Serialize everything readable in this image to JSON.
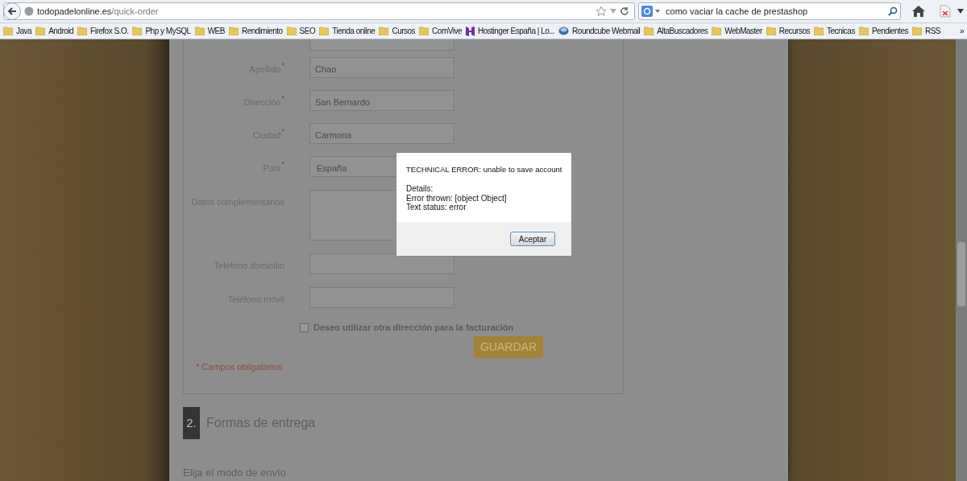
{
  "browser": {
    "url_domain": "todopadelonline.es",
    "url_path": "/quick-order",
    "search_query": "como vaciar la cache de prestashop",
    "bookmarks": [
      {
        "label": "Java",
        "kind": "folder"
      },
      {
        "label": "Android",
        "kind": "folder"
      },
      {
        "label": "Firefox S.O.",
        "kind": "folder"
      },
      {
        "label": "Php y MySQL",
        "kind": "folder"
      },
      {
        "label": "WEB",
        "kind": "folder"
      },
      {
        "label": "Rendimiento",
        "kind": "folder"
      },
      {
        "label": "SEO",
        "kind": "folder"
      },
      {
        "label": "Tienda online",
        "kind": "folder"
      },
      {
        "label": "Cursos",
        "kind": "folder"
      },
      {
        "label": "ComVive",
        "kind": "folder"
      },
      {
        "label": "Hostinger España | Lo...",
        "kind": "site"
      },
      {
        "label": "Roundcube Webmail",
        "kind": "mail"
      },
      {
        "label": "AltaBuscadores",
        "kind": "folder"
      },
      {
        "label": "WebMaster",
        "kind": "folder"
      },
      {
        "label": "Recursos",
        "kind": "folder"
      },
      {
        "label": "Tecnicas",
        "kind": "folder"
      },
      {
        "label": "Pendientes",
        "kind": "folder"
      },
      {
        "label": "RSS",
        "kind": "folder"
      }
    ],
    "bookmarks_overflow": "»"
  },
  "form": {
    "fields": [
      {
        "kind": "input",
        "required": false
      },
      {
        "kind": "input",
        "label": "Apellido",
        "required": true,
        "value": "Chao"
      },
      {
        "kind": "input",
        "label": "Dirección",
        "required": true,
        "value": "San Bernardo"
      },
      {
        "kind": "input",
        "label": "Ciudad",
        "required": true,
        "value": "Carmona"
      },
      {
        "kind": "select",
        "label": "País",
        "required": true,
        "value": "España"
      },
      {
        "kind": "textarea",
        "label": "Datos complementarios",
        "required": false
      },
      {
        "kind": "input",
        "label": "Teléfono domicilio",
        "required": false
      },
      {
        "kind": "input",
        "label": "Teléfono móvil",
        "required": false
      }
    ],
    "required_mark": "*",
    "checkbox": {
      "label": "Deseo utilizar otra dirección para la facturación",
      "checked": false
    },
    "save_button": "GUARDAR",
    "required_note": "* Campos obligatorios"
  },
  "section": {
    "number": "2.",
    "title": "Formas de entrega",
    "subheading": "Elija el modo de envío"
  },
  "dialog": {
    "title": "TECHNICAL ERROR: unable to save account",
    "details": [
      "Details:",
      "Error thrown: [object Object]",
      "Text status: error"
    ],
    "button": "Aceptar"
  }
}
